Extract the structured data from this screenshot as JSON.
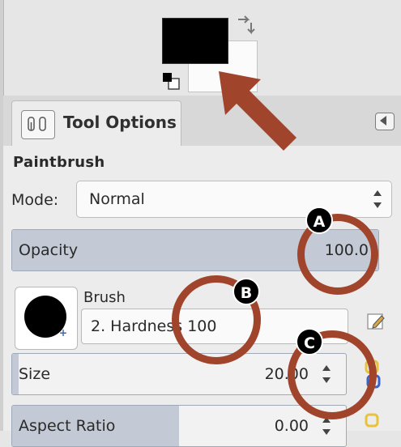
{
  "tab": {
    "label": "Tool Options"
  },
  "tool": {
    "name": "Paintbrush"
  },
  "mode": {
    "label": "Mode:",
    "value": "Normal"
  },
  "opacity": {
    "label": "Opacity",
    "value": "100.0",
    "fraction": 1.0
  },
  "brush": {
    "label": "Brush",
    "value": "2. Hardness 100"
  },
  "size": {
    "label": "Size",
    "value": "20.00",
    "fraction": 0.02
  },
  "aspect_ratio": {
    "label": "Aspect Ratio",
    "value": "0.00",
    "fraction": 0.5
  },
  "annotations": {
    "a": "A",
    "b": "B",
    "c": "C"
  },
  "colors": {
    "foreground": "#000000",
    "background": "#ffffff",
    "annotation": "#a0452b"
  },
  "icons": [
    "swap-colors-icon",
    "reset-colors-icon",
    "tool-options-icon",
    "panel-menu-icon",
    "brush-edit-icon",
    "chain-link-icon"
  ]
}
